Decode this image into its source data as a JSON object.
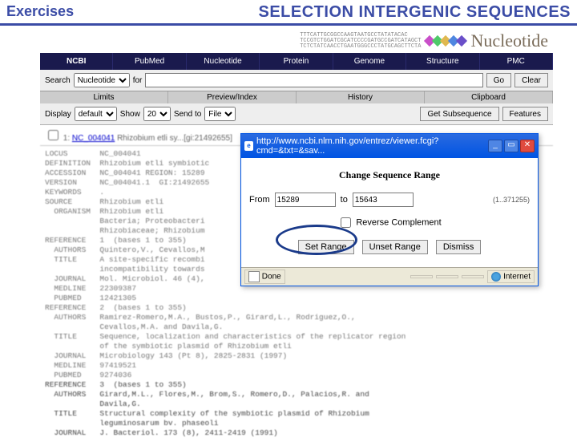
{
  "slide": {
    "left": "Exercises",
    "title": "SELECTION INTERGENIC SEQUENCES"
  },
  "banner": {
    "word": "Nucleotide"
  },
  "nav": [
    "NCBI",
    "PubMed",
    "Nucleotide",
    "Protein",
    "Genome",
    "Structure",
    "PMC"
  ],
  "search": {
    "label": "Search",
    "select": "Nucleotide",
    "for": "for",
    "go": "Go",
    "clear": "Clear",
    "value": ""
  },
  "sub1": [
    "Limits",
    "Preview/Index",
    "History",
    "Clipboard"
  ],
  "display": {
    "label": "Display",
    "format": "default",
    "show_label": "Show",
    "show": "20",
    "sendto_label": "Send to",
    "sendto": "File",
    "btn1": "Get Subsequence",
    "btn2": "Features"
  },
  "result": {
    "index": "1:",
    "acc": "NC_004041",
    "desc": "Rhizobium etli sy...[gi:21492655]"
  },
  "record_text": "LOCUS       NC_004041\nDEFINITION  Rhizobium etli symbiotic\nACCESSION   NC_004041 REGION: 15289\nVERSION     NC_004041.1  GI:21492655\nKEYWORDS    .\nSOURCE      Rhizobium etli\n  ORGANISM  Rhizobium etli\n            Bacteria; Proteobacteri\n            Rhizobiaceae; Rhizobium\nREFERENCE   1  (bases 1 to 355)\n  AUTHORS   Quintero,V., Cevallos,M\n  TITLE     A site-specific recombi\n            incompatibility towards\n  JOURNAL   Mol. Microbiol. 46 (4),\n  MEDLINE   22309387\n  PUBMED    12421305\nREFERENCE   2  (bases 1 to 355)\n  AUTHORS   Ramirez-Romero,M.A., Bustos,P., Girard,L., Rodriguez,O.,\n            Cevallos,M.A. and Davila,G.\n  TITLE     Sequence, localization and characteristics of the replicator region\n            of the symbiotic plasmid of Rhizobium etli\n  JOURNAL   Microbiology 143 (Pt 8), 2825-2831 (1997)\n  MEDLINE   97419521\n  PUBMED    9274036",
  "record_tail": "REFERENCE   3  (bases 1 to 355)\n  AUTHORS   Girard,M.L., Flores,M., Brom,S., Romero,D., Palacios,R. and\n            Davila,G.\n  TITLE     Structural complexity of the symbiotic plasmid of Rhizobium\n            leguminosarum bv. phaseoli\n  JOURNAL   J. Bacteriol. 173 (8), 2411-2419 (1991)",
  "dialog": {
    "url": "http://www.ncbi.nlm.nih.gov/entrez/viewer.fcgi?cmd=&txt=&sav...",
    "heading": "Change Sequence Range",
    "from_label": "From",
    "from": "15289",
    "to_label": "to",
    "to": "15643",
    "max": "(1..371255)",
    "reverse": "Reverse Complement",
    "set": "Set Range",
    "unset": "Unset Range",
    "dismiss": "Dismiss",
    "status_done": "Done",
    "status_zone": "Internet"
  }
}
